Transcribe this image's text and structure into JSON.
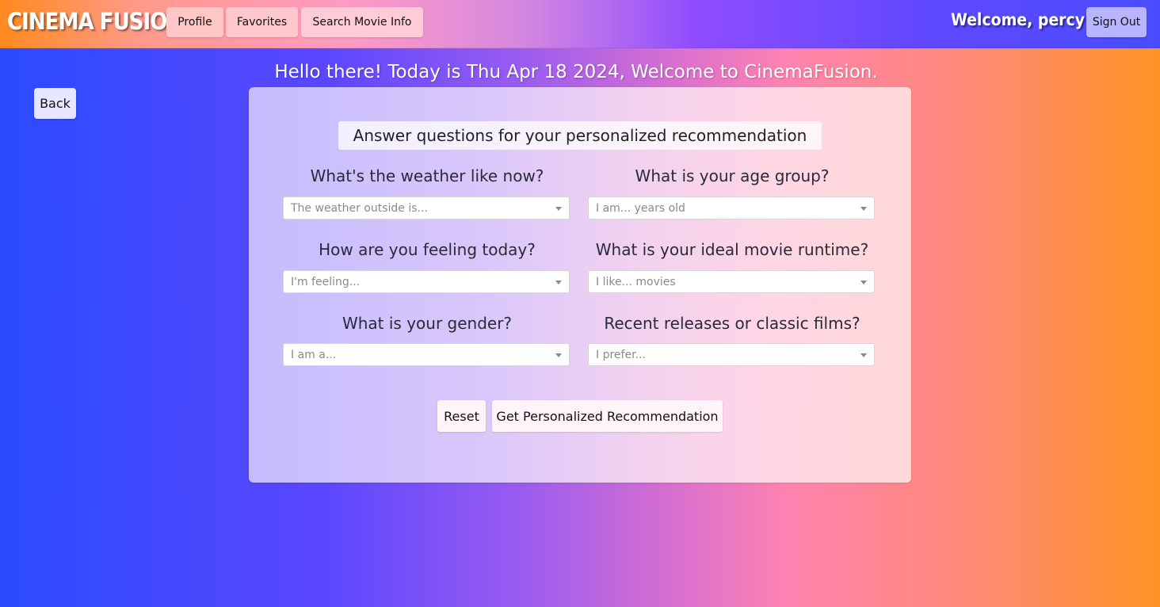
{
  "navbar": {
    "brand": "CINEMA FUSION",
    "links": {
      "profile": "Profile",
      "favorites": "Favorites",
      "search": "Search Movie Info"
    },
    "welcome": "Welcome, percy",
    "signout": "Sign Out"
  },
  "greeting": "Hello there! Today is Thu Apr 18 2024, Welcome to CinemaFusion.",
  "back_label": "Back",
  "form": {
    "title": "Answer questions for your personalized recommendation",
    "weather": {
      "question": "What's the weather like now?",
      "placeholder": "The weather outside is..."
    },
    "age": {
      "question": "What is your age group?",
      "placeholder": "I am... years old"
    },
    "feeling": {
      "question": "How are you feeling today?",
      "placeholder": "I'm feeling..."
    },
    "runtime": {
      "question": "What is your ideal movie runtime?",
      "placeholder": "I like... movies"
    },
    "gender": {
      "question": "What is your gender?",
      "placeholder": "I am a..."
    },
    "release": {
      "question": "Recent releases or classic films?",
      "placeholder": "I prefer..."
    },
    "reset_label": "Reset",
    "submit_label": "Get Personalized Recommendation"
  },
  "colors": {
    "accent_left": "#2a4bff",
    "accent_mid": "#ff83b0",
    "accent_right": "#ff9424"
  }
}
